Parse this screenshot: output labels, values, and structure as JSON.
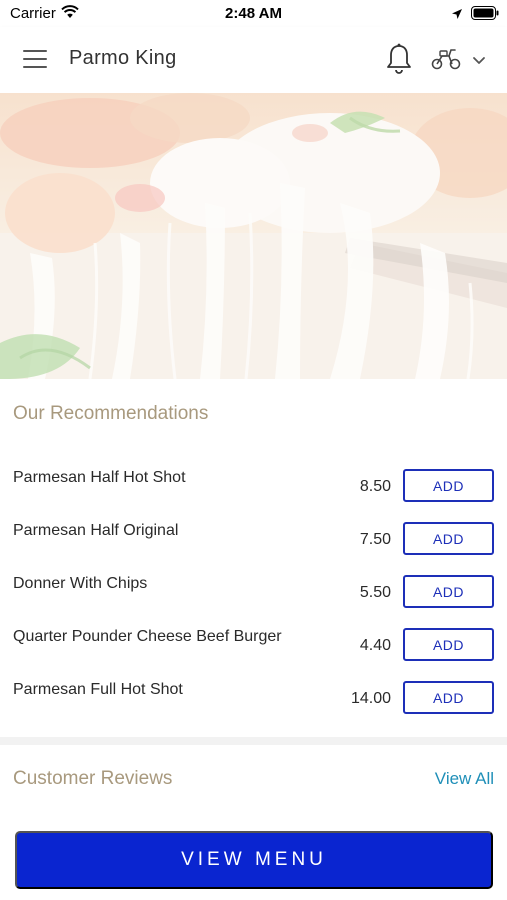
{
  "status_bar": {
    "carrier": "Carrier",
    "time": "2:48 AM"
  },
  "header": {
    "title": "Parmo King",
    "menu_icon": "hamburger-menu-icon",
    "notification_icon": "bell-icon",
    "delivery_icon": "scooter-icon",
    "dropdown_icon": "chevron-down-icon"
  },
  "hero": {
    "image": "cheesy-pizza-photo"
  },
  "recommendations": {
    "title": "Our Recommendations",
    "items": [
      {
        "name": "Parmesan Half Hot Shot",
        "price": "8.50",
        "button": "ADD"
      },
      {
        "name": "Parmesan Half Original",
        "price": "7.50",
        "button": "ADD"
      },
      {
        "name": "Donner With Chips",
        "price": "5.50",
        "button": "ADD"
      },
      {
        "name": "Quarter Pounder Cheese Beef Burger",
        "price": "4.40",
        "button": "ADD"
      },
      {
        "name": "Parmesan Full Hot Shot",
        "price": "14.00",
        "button": "ADD"
      }
    ]
  },
  "reviews": {
    "title": "Customer Reviews",
    "view_all": "View All"
  },
  "footer": {
    "view_menu": "VIEW MENU"
  },
  "colors": {
    "accent_blue": "#0a25d0",
    "add_border": "#1d2fb8",
    "section_title": "#a8997e",
    "link": "#1f8fb8"
  }
}
